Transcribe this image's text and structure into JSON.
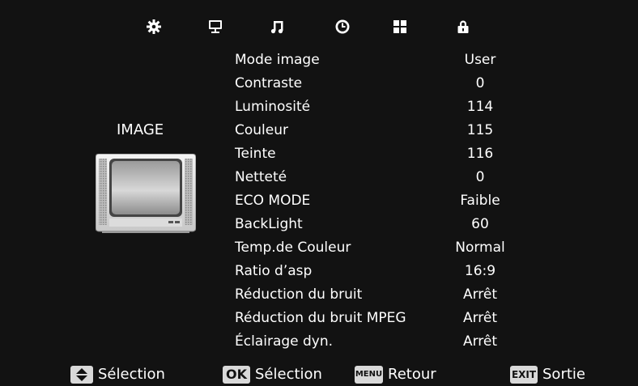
{
  "icons": [
    {
      "name": "settings-gear-icon",
      "glyph": "gear"
    },
    {
      "name": "monitor-icon",
      "glyph": "monitor"
    },
    {
      "name": "music-note-icon",
      "glyph": "note"
    },
    {
      "name": "clock-icon",
      "glyph": "clock"
    },
    {
      "name": "grid-icon",
      "glyph": "grid"
    },
    {
      "name": "lock-icon",
      "glyph": "lock"
    }
  ],
  "section_title": "IMAGE",
  "menu": [
    {
      "label": "Mode image",
      "value": "User"
    },
    {
      "label": "Contraste",
      "value": "0"
    },
    {
      "label": "Luminosité",
      "value": "114"
    },
    {
      "label": "Couleur",
      "value": "115"
    },
    {
      "label": "Teinte",
      "value": "116"
    },
    {
      "label": "Netteté",
      "value": "0"
    },
    {
      "label": "ECO MODE",
      "value": "Faible"
    },
    {
      "label": "BackLight",
      "value": "60"
    },
    {
      "label": "Temp.de Couleur",
      "value": "Normal"
    },
    {
      "label": "Ratio d’asp",
      "value": "16:9"
    },
    {
      "label": "Réduction du bruit",
      "value": "Arrêt"
    },
    {
      "label": "Réduction du bruit MPEG",
      "value": "Arrêt"
    },
    {
      "label": "Éclairage dyn.",
      "value": "Arrêt"
    }
  ],
  "hints": {
    "updown": {
      "key": "",
      "text": "Sélection"
    },
    "ok": {
      "key": "OK",
      "text": "Sélection"
    },
    "menu": {
      "key": "MENU",
      "text": "Retour"
    },
    "exit": {
      "key": "EXIT",
      "text": "Sortie"
    }
  }
}
